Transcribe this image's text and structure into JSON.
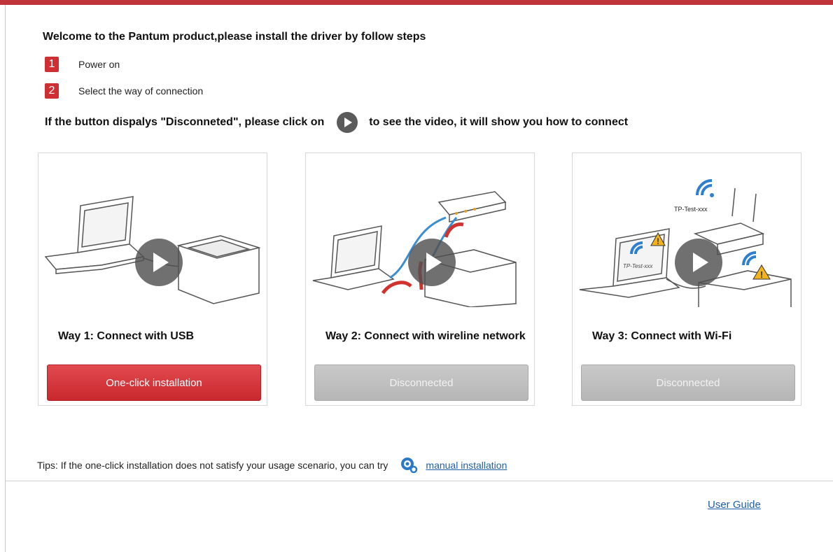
{
  "header": {
    "title": "Welcome to the Pantum product,please install the driver by follow steps",
    "steps": [
      {
        "number": "1",
        "text": "Power on"
      },
      {
        "number": "2",
        "text": "Select the way of connection"
      }
    ],
    "hint_before": "If the button dispalys \"Disconneted\", please click on",
    "hint_after": "to see the video, it will show you how to connect"
  },
  "cards": [
    {
      "label": "Way 1: Connect with USB",
      "button": "One-click installation",
      "button_state": "enabled"
    },
    {
      "label": "Way 2: Connect with wireline network",
      "button": "Disconnected",
      "button_state": "disabled"
    },
    {
      "label": "Way 3: Connect with Wi-Fi",
      "button": "Disconnected",
      "button_state": "disabled",
      "ssid_labels": [
        "TP-Test-xxx",
        "TP-Test-xxx"
      ]
    }
  ],
  "footer": {
    "tips": "Tips: If the one-click installation does not satisfy your usage scenario, you can try",
    "manual_link": "manual installation",
    "user_guide": "User Guide"
  },
  "colors": {
    "accent": "#cf2e33",
    "link": "#1f5fa8",
    "disabled": "#bdbdbd"
  }
}
